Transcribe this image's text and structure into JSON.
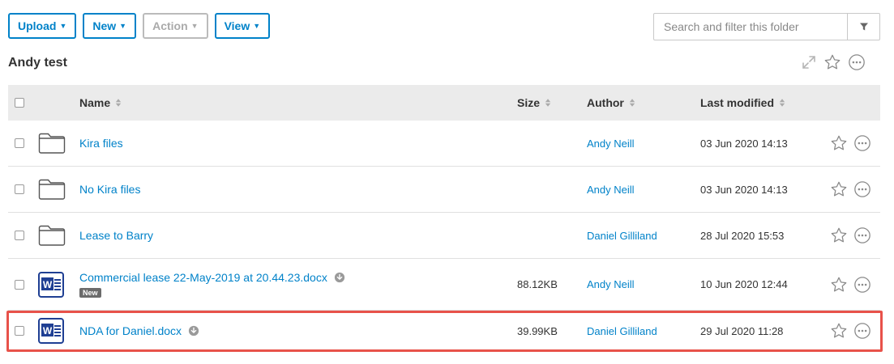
{
  "toolbar": {
    "upload_label": "Upload",
    "new_label": "New",
    "action_label": "Action",
    "view_label": "View"
  },
  "search": {
    "placeholder": "Search and filter this folder"
  },
  "folder": {
    "title": "Andy test"
  },
  "table": {
    "headers": {
      "name": "Name",
      "size": "Size",
      "author": "Author",
      "modified": "Last modified"
    },
    "rows": [
      {
        "type": "folder",
        "name": "Kira files",
        "size": "",
        "author": "Andy Neill",
        "modified": "03 Jun 2020 14:13"
      },
      {
        "type": "folder",
        "name": "No Kira files",
        "size": "",
        "author": "Andy Neill",
        "modified": "03 Jun 2020 14:13"
      },
      {
        "type": "folder",
        "name": "Lease to Barry",
        "size": "",
        "author": "Daniel Gilliland",
        "modified": "28 Jul 2020 15:53"
      },
      {
        "type": "word-document",
        "name": "Commercial lease 22-May-2019 at 20.44.23.docx",
        "badge": "New",
        "size": "88.12KB",
        "author": "Andy Neill",
        "modified": "10 Jun 2020 12:44"
      },
      {
        "type": "word-document",
        "name": "NDA for Daniel.docx",
        "size": "39.99KB",
        "author": "Daniel Gilliland",
        "modified": "29 Jul 2020 11:28",
        "highlighted": true
      }
    ]
  },
  "colors": {
    "accent": "#0082c9",
    "highlight": "#e8524a",
    "header_bg": "#ebebeb",
    "word_blue": "#1f3f93"
  }
}
